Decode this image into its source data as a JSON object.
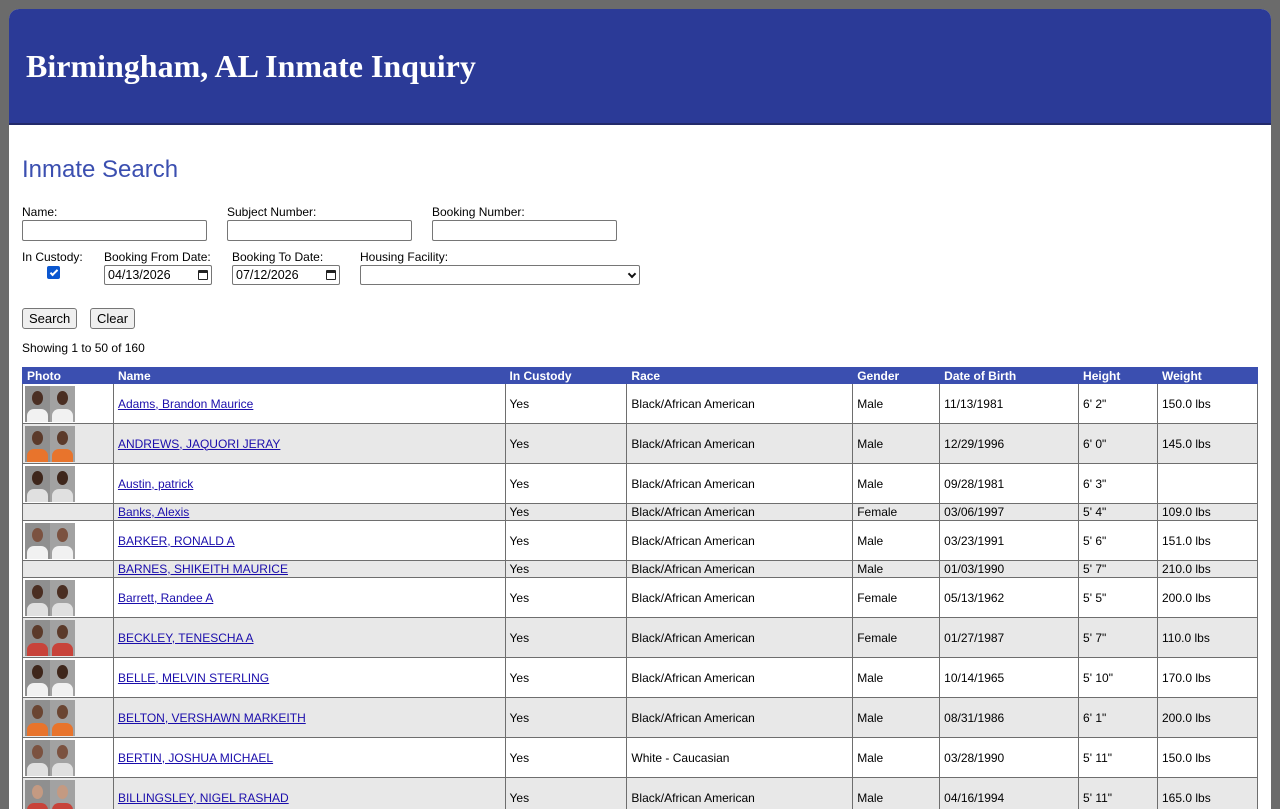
{
  "header": {
    "title": "Birmingham, AL Inmate Inquiry"
  },
  "search": {
    "title": "Inmate Search",
    "name_label": "Name:",
    "name_value": "",
    "subject_label": "Subject Number:",
    "subject_value": "",
    "booking_label": "Booking Number:",
    "booking_value": "",
    "custody_label": "In Custody:",
    "custody_checked": true,
    "from_label": "Booking From Date:",
    "from_value": "04/13/2026",
    "to_label": "Booking To Date:",
    "to_value": "07/12/2026",
    "facility_label": "Housing Facility:",
    "facility_value": "",
    "search_button": "Search",
    "clear_button": "Clear",
    "showing": "Showing 1 to 50 of 160"
  },
  "table": {
    "columns": [
      "Photo",
      "Name",
      "In Custody",
      "Race",
      "Gender",
      "Date of Birth",
      "Height",
      "Weight"
    ],
    "rows": [
      {
        "photo": true,
        "name": "Adams, Brandon Maurice",
        "custody": "Yes",
        "race": "Black/African American",
        "gender": "Male",
        "dob": "11/13/1981",
        "height": "6' 2\"",
        "weight": "150.0 lbs"
      },
      {
        "photo": true,
        "name": "ANDREWS, JAQUORI JERAY",
        "custody": "Yes",
        "race": "Black/African American",
        "gender": "Male",
        "dob": "12/29/1996",
        "height": "6' 0\"",
        "weight": "145.0 lbs"
      },
      {
        "photo": true,
        "name": "Austin, patrick",
        "custody": "Yes",
        "race": "Black/African American",
        "gender": "Male",
        "dob": "09/28/1981",
        "height": "6' 3\"",
        "weight": ""
      },
      {
        "photo": false,
        "name": "Banks, Alexis",
        "custody": "Yes",
        "race": "Black/African American",
        "gender": "Female",
        "dob": "03/06/1997",
        "height": "5' 4\"",
        "weight": "109.0 lbs"
      },
      {
        "photo": true,
        "name": "BARKER, RONALD A",
        "custody": "Yes",
        "race": "Black/African American",
        "gender": "Male",
        "dob": "03/23/1991",
        "height": "5' 6\"",
        "weight": "151.0 lbs"
      },
      {
        "photo": false,
        "name": "BARNES, SHIKEITH MAURICE",
        "custody": "Yes",
        "race": "Black/African American",
        "gender": "Male",
        "dob": "01/03/1990",
        "height": "5' 7\"",
        "weight": "210.0 lbs"
      },
      {
        "photo": true,
        "name": "Barrett, Randee A",
        "custody": "Yes",
        "race": "Black/African American",
        "gender": "Female",
        "dob": "05/13/1962",
        "height": "5' 5\"",
        "weight": "200.0 lbs"
      },
      {
        "photo": true,
        "name": "BECKLEY, TENESCHA A",
        "custody": "Yes",
        "race": "Black/African American",
        "gender": "Female",
        "dob": "01/27/1987",
        "height": "5' 7\"",
        "weight": "110.0 lbs"
      },
      {
        "photo": true,
        "name": "BELLE, MELVIN STERLING",
        "custody": "Yes",
        "race": "Black/African American",
        "gender": "Male",
        "dob": "10/14/1965",
        "height": "5' 10\"",
        "weight": "170.0 lbs"
      },
      {
        "photo": true,
        "name": "BELTON, VERSHAWN MARKEITH",
        "custody": "Yes",
        "race": "Black/African American",
        "gender": "Male",
        "dob": "08/31/1986",
        "height": "6' 1\"",
        "weight": "200.0 lbs"
      },
      {
        "photo": true,
        "name": "BERTIN, JOSHUA MICHAEL",
        "custody": "Yes",
        "race": "White - Caucasian",
        "gender": "Male",
        "dob": "03/28/1990",
        "height": "5' 11\"",
        "weight": "150.0 lbs"
      },
      {
        "photo": true,
        "name": "BILLINGSLEY, NIGEL RASHAD",
        "custody": "Yes",
        "race": "Black/African American",
        "gender": "Male",
        "dob": "04/16/1994",
        "height": "5' 11\"",
        "weight": "165.0 lbs"
      }
    ]
  },
  "colors": {
    "banner": "#2b3a97",
    "accent": "#3b4fb0",
    "link": "#1a0dab",
    "alt_row": "#e8e8e8"
  },
  "icons": {
    "date_picker": "calendar-icon",
    "select": "chevron-down-icon",
    "checkbox": "checkmark-icon"
  }
}
